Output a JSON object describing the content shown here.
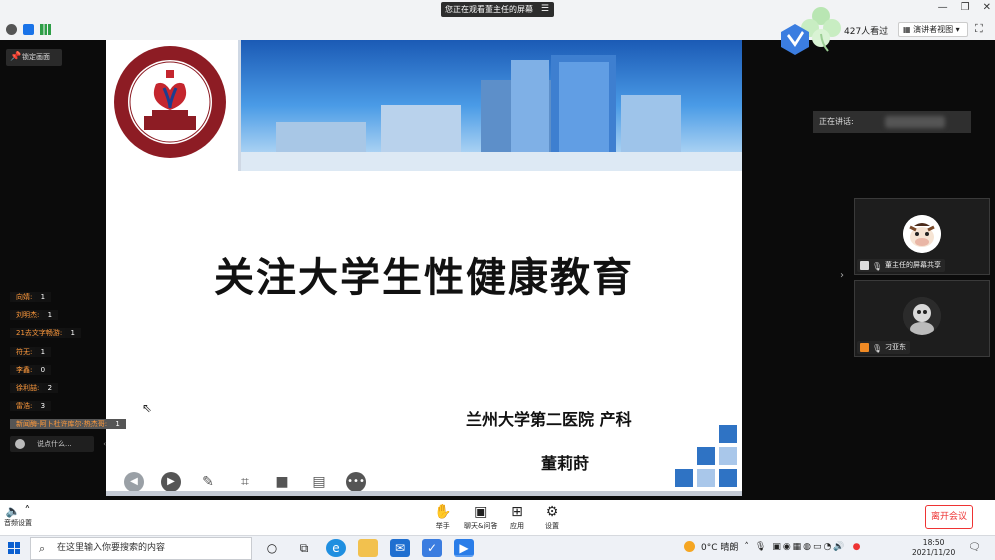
{
  "banner": {
    "viewing_text": "您正在观看董主任的屏幕",
    "menu_icon": "menu-icon"
  },
  "header": {
    "viewers": "427人看过",
    "speaker_view": "演讲者视图",
    "lock_screen": "锁定画面",
    "icons": [
      "info-icon",
      "shield-icon",
      "signal-icon",
      "fullscreen-icon",
      "minimize-icon",
      "restore-icon",
      "close-icon"
    ]
  },
  "slide": {
    "title": "关注大学生性健康教育",
    "affiliation": "兰州大学第二医院  产科",
    "author": "董莉莳",
    "logo_text": "LANZHOU UNIVERSITY SECOND HOSPITAL",
    "logo_chinese": "兰州大学第二医院",
    "logo_year": "1928",
    "tools": [
      "prev-icon",
      "play-icon",
      "pen-icon",
      "screenshot-icon",
      "camera-icon",
      "comment-icon",
      "more-icon"
    ]
  },
  "speaking": {
    "label": "正在讲话:"
  },
  "participants": [
    {
      "name": "董主任的屏幕共享"
    },
    {
      "name": "刁亚东"
    }
  ],
  "chat": {
    "lines": [
      {
        "name": "向婧:",
        "count": "1"
      },
      {
        "name": "刘明杰:",
        "count": "1"
      },
      {
        "name": "21去文字畅游:",
        "count": "1"
      },
      {
        "name": "符无:",
        "count": "1"
      },
      {
        "name": "李鑫:",
        "count": "0"
      },
      {
        "name": "徐利喆:",
        "count": "2"
      },
      {
        "name": "雷浩:",
        "count": "3"
      },
      {
        "name": "新闻酶-阿卜杜许库尔·热杰哥:",
        "count": "1"
      }
    ],
    "placeholder": "说点什么..."
  },
  "controls": {
    "audio": "音频设置",
    "raise_hand": "举手",
    "chat_qa": "聊天&问答",
    "apps": "应用",
    "settings": "设置",
    "leave": "离开会议"
  },
  "taskbar": {
    "search_placeholder": "在这里输入你要搜索的内容",
    "weather": "0°C  晴朗",
    "time": "18:50",
    "date": "2021/11/20"
  }
}
